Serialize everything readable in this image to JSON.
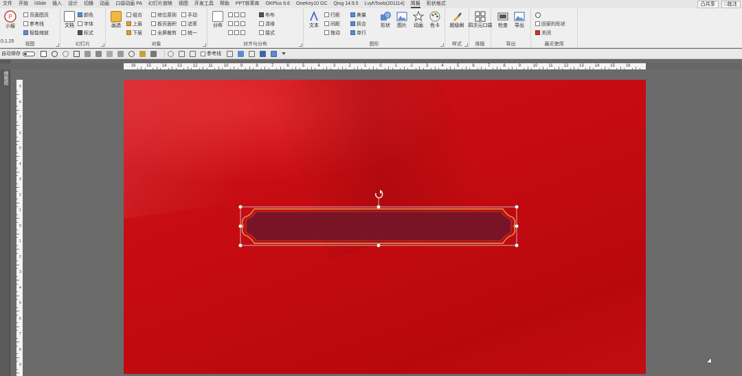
{
  "menubar": {
    "items": [
      {
        "label": "文件",
        "active": false
      },
      {
        "label": "开始",
        "active": false
      },
      {
        "label": "iSlide",
        "active": false
      },
      {
        "label": "插入",
        "active": false
      },
      {
        "label": "设计",
        "active": false
      },
      {
        "label": "切换",
        "active": false
      },
      {
        "label": "动画",
        "active": false
      },
      {
        "label": "口袋动画 PA",
        "active": false
      },
      {
        "label": "幻灯片放映",
        "active": false
      },
      {
        "label": "视图",
        "active": false
      },
      {
        "label": "开发工具",
        "active": false
      },
      {
        "label": "帮助",
        "active": false
      },
      {
        "label": "PPT效率库",
        "active": false
      },
      {
        "label": "OKPlus 6.6",
        "active": false
      },
      {
        "label": "OneKey10 GC",
        "active": false
      },
      {
        "label": "Qing 14.9.5",
        "active": false
      },
      {
        "label": "LvyhTools(201114)",
        "active": false
      },
      {
        "label": "简报",
        "active": true
      },
      {
        "label": "形状格式",
        "active": false
      }
    ],
    "share": "凸共享",
    "comments": "□批注"
  },
  "ribbon": {
    "g_view": {
      "label": "视图",
      "big": "小报",
      "version": "0.1.25",
      "items": [
        "页面图页",
        "参考线",
        "智能缩放"
      ]
    },
    "g_slide": {
      "label": "幻灯片",
      "big": "文档",
      "items": [
        "颜色",
        "字体",
        "标式"
      ]
    },
    "g_object": {
      "label": "对象",
      "big": "画选",
      "col1": [
        "组合",
        "上层",
        "下层"
      ],
      "col2": [
        "修位原则",
        "板页面积",
        "全屏裁剪"
      ],
      "col3": [
        "手动",
        "滤率",
        "统一"
      ]
    },
    "g_align": {
      "label": "对齐与分布",
      "big": "分布",
      "items": [
        "布布",
        "清缘",
        "接式"
      ]
    },
    "g_graphic": {
      "label": "图形",
      "text_big": "文本",
      "col1": [
        "行距",
        "间距",
        "拖动"
      ],
      "col2": [
        "美量",
        "拆合",
        "单行"
      ],
      "bigs": [
        "形状",
        "图片",
        "动画",
        "色卡"
      ]
    },
    "g_style": {
      "label": "样式",
      "big": "超级刷"
    },
    "g_layout": {
      "label": "排版",
      "big": "四次元口袋"
    },
    "g_export": {
      "label": "导出",
      "bigs": [
        "检查",
        "导出"
      ]
    },
    "g_recent": {
      "label": "最近使用",
      "items": [
        "回家的形状",
        "关闭"
      ]
    }
  },
  "qat": {
    "autosave": "自动保存",
    "checkbox": "参考线"
  },
  "leftpane": {
    "label": "缩略图"
  },
  "ruler": {
    "h_labels": [
      "16",
      "15",
      "14",
      "13",
      "12",
      "11",
      "10",
      "9",
      "8",
      "7",
      "6",
      "5",
      "4",
      "3",
      "2",
      "1",
      "0",
      "1",
      "2",
      "3",
      "4",
      "5",
      "6",
      "7",
      "8",
      "9",
      "10",
      "11",
      "12",
      "13",
      "14",
      "15",
      "16"
    ],
    "v_labels": [
      "9",
      "8",
      "7",
      "6",
      "5",
      "4",
      "3",
      "2",
      "1",
      "0",
      "1",
      "2",
      "3",
      "4",
      "5",
      "6",
      "7",
      "8",
      "9"
    ]
  },
  "colors": {
    "slide_red": "#c80d14",
    "banner_fill": "#7a1426",
    "banner_border": "#d9a35a",
    "handle": "#ffffff",
    "selection": "#c9c9c9"
  }
}
